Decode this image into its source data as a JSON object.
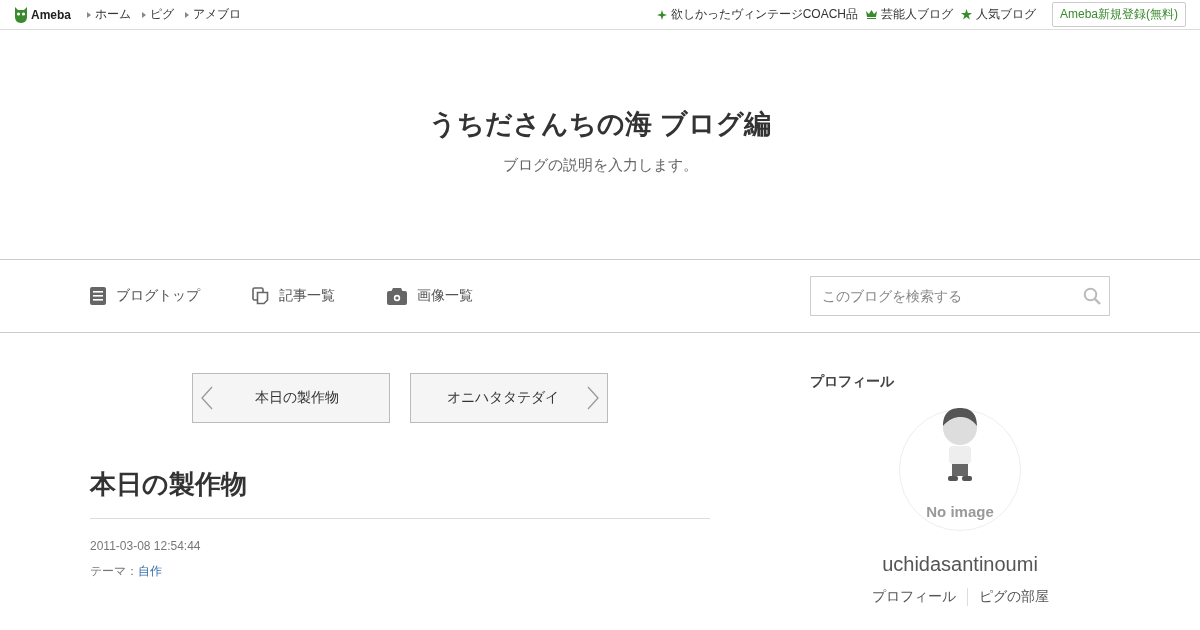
{
  "header": {
    "logo": "Ameba",
    "nav": [
      "ホーム",
      "ピグ",
      "アメブロ"
    ],
    "links": [
      {
        "kind": "sparkle",
        "label": "欲しかったヴィンテージCOACH品"
      },
      {
        "kind": "crown",
        "label": "芸能人ブログ"
      },
      {
        "kind": "star",
        "label": "人気ブログ"
      }
    ],
    "signup": "Ameba新規登録(無料)"
  },
  "blog": {
    "title": "うちださんちの海 ブログ編",
    "description": "ブログの説明を入力します。"
  },
  "menu": [
    {
      "kind": "top",
      "label": "ブログトップ"
    },
    {
      "kind": "list",
      "label": "記事一覧"
    },
    {
      "kind": "images",
      "label": "画像一覧"
    }
  ],
  "search": {
    "placeholder": "このブログを検索する"
  },
  "pager": {
    "prev": "本日の製作物",
    "next": "オニハタタテダイ"
  },
  "article": {
    "title": "本日の製作物",
    "date": "2011-03-08 12:54:44",
    "theme_label": "テーマ：",
    "theme": "自作"
  },
  "profile": {
    "heading": "プロフィール",
    "avatar_label": "No image",
    "name": "uchidasantinoumi",
    "links": [
      "プロフィール",
      "ピグの部屋"
    ]
  }
}
